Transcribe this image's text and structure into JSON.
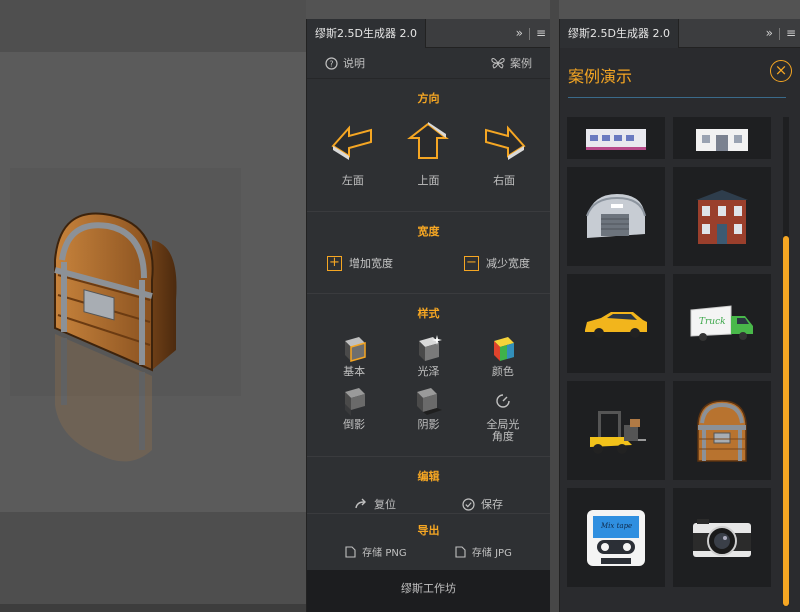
{
  "generator_panel": {
    "tab_title": "缪斯2.5D生成器 2.0",
    "help_label": "说明",
    "examples_label": "案例",
    "direction": {
      "title": "方向",
      "left": "左面",
      "top": "上面",
      "right": "右面"
    },
    "width": {
      "title": "宽度",
      "increase": "增加宽度",
      "decrease": "减少宽度"
    },
    "style": {
      "title": "样式",
      "basic": "基本",
      "gloss": "光泽",
      "color": "颜色",
      "reflection": "倒影",
      "shadow": "阴影",
      "global_light": "全局光\n角度"
    },
    "edit": {
      "title": "编辑",
      "reset": "复位",
      "save": "保存"
    },
    "export": {
      "title": "导出",
      "png": "存储 PNG",
      "jpg": "存储 JPG"
    },
    "footer": "缪斯工作坊"
  },
  "examples_panel": {
    "tab_title": "缪斯2.5D生成器 2.0",
    "title": "案例演示",
    "tiles": [
      "building-partial-icon",
      "house-partial-icon",
      "hangar-icon",
      "brick-house-icon",
      "taxi-car-icon",
      "delivery-truck-icon",
      "forklift-icon",
      "wooden-chest-icon",
      "cassette-tape-icon",
      "camera-icon"
    ]
  },
  "colors": {
    "accent": "#f5a623",
    "panel_bg": "#2e3033",
    "tile_bg": "#1e1f21"
  }
}
